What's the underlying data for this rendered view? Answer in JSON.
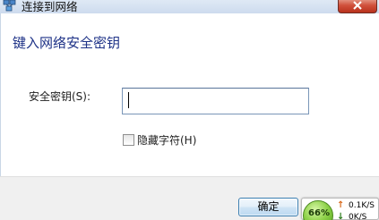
{
  "window": {
    "title": "连接到网络",
    "icon": "network-icon",
    "close_icon": "close-icon"
  },
  "dialog": {
    "heading": "键入网络安全密钥",
    "security_key_label": "安全密钥(S):",
    "security_key_value": "",
    "hide_characters_label": "隐藏字符(H)",
    "hide_characters_checked": false
  },
  "footer": {
    "ok_label": "确定"
  },
  "network_widget": {
    "usage_percent": "66%",
    "upload_speed": "0.1K/S",
    "download_speed": "0K/S"
  },
  "colors": {
    "heading": "#1e3287",
    "titlebar": "#cddbee",
    "close_button": "#c7402a",
    "ok_button_border": "#3c7fb1",
    "widget_ball": "#8fd24a"
  }
}
